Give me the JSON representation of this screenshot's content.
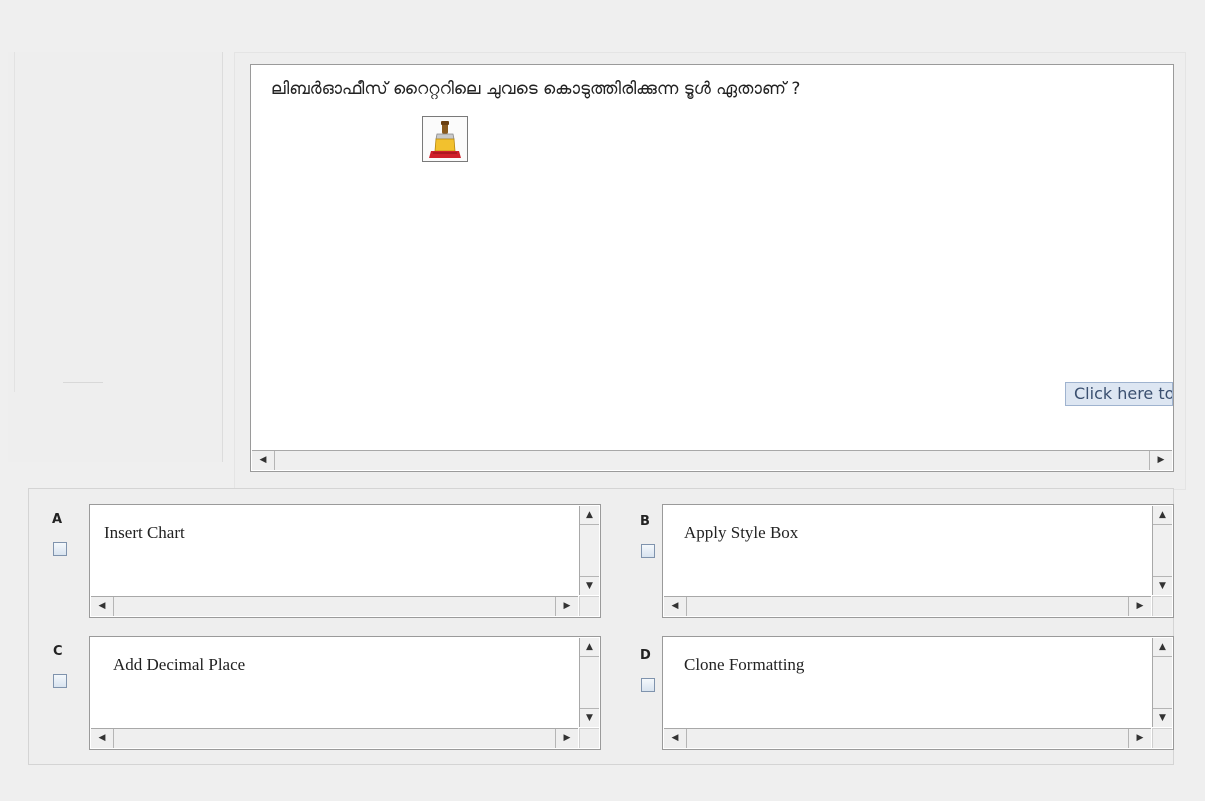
{
  "question": {
    "text": "ലിബർഓഫീസ് റൈറ്ററിലെ ചുവടെ കൊടുത്തിരിക്കുന്ന ടൂൾ ഏതാണ് ?",
    "tool_icon": "paintbrush-clone-formatting-icon",
    "hint": "Click here to"
  },
  "options": [
    {
      "letter": "A",
      "text": "Insert Chart"
    },
    {
      "letter": "B",
      "text": "Apply Style Box"
    },
    {
      "letter": "C",
      "text": "Add Decimal Place"
    },
    {
      "letter": "D",
      "text": "Clone Formatting"
    }
  ],
  "scroll_glyphs": {
    "left": "◀",
    "right": "▶",
    "up": "▲",
    "down": "▼"
  }
}
